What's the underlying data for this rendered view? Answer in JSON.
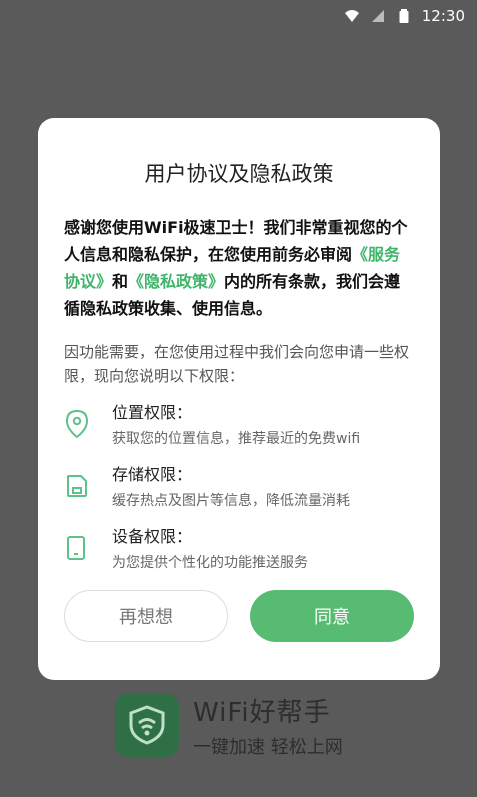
{
  "status_bar": {
    "time": "12:30"
  },
  "background_app": {
    "name": "WiFi好帮手",
    "slogan": "一键加速 轻松上网"
  },
  "dialog": {
    "title": "用户协议及隐私政策",
    "intro_part1": "感谢您使用WiFi极速卫士！我们非常重视您的个人信息和隐私保护，在您使用前务必审阅",
    "link_service": "《服务协议》",
    "intro_and": "和",
    "link_privacy": "《隐私政策》",
    "intro_part2": "内的所有条款，我们会遵循隐私政策收集、使用信息。",
    "notice": "因功能需要，在您使用过程中我们会向您申请一些权限，现向您说明以下权限：",
    "permissions": [
      {
        "icon": "location-pin-icon",
        "name": "位置权限：",
        "desc": "获取您的位置信息，推荐最近的免费wifi"
      },
      {
        "icon": "storage-icon",
        "name": "存储权限：",
        "desc": "缓存热点及图片等信息，降低流量消耗"
      },
      {
        "icon": "device-phone-icon",
        "name": "设备权限：",
        "desc": "为您提供个性化的功能推送服务"
      }
    ],
    "cancel_label": "再想想",
    "agree_label": "同意"
  },
  "colors": {
    "accent": "#57bb72",
    "link": "#3fb56a"
  }
}
